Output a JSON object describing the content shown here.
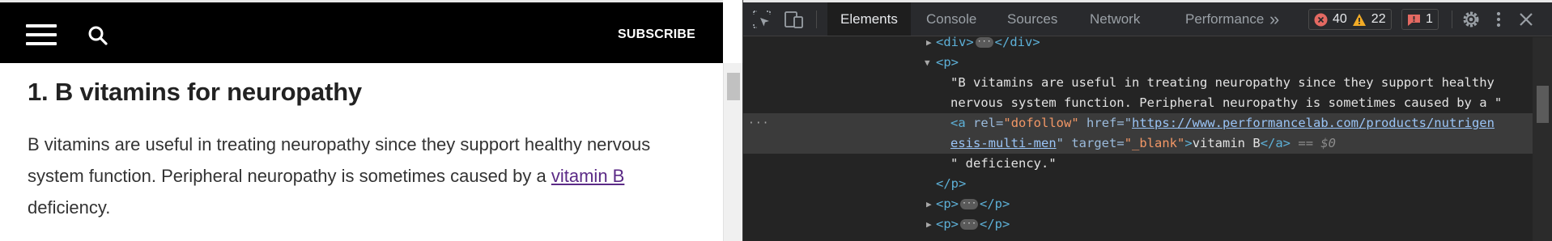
{
  "page": {
    "header": {
      "menu_icon": "hamburger-icon",
      "search_icon": "search-icon",
      "subscribe_label": "SUBSCRIBE"
    },
    "article": {
      "heading": "1. B vitamins for neuropathy",
      "para_before": "B vitamins are useful in treating neuropathy since they support healthy nervous system function. Peripheral neuropathy is sometimes caused by a ",
      "link_text": "vitamin B",
      "para_after": " deficiency."
    }
  },
  "devtools": {
    "toolbar": {
      "inspect_icon": "inspect-element-icon",
      "device_icon": "device-toolbar-icon",
      "tabs": [
        "Elements",
        "Console",
        "Sources",
        "Network",
        "Performance"
      ],
      "more_tabs": "»",
      "errors_count": "40",
      "warnings_count": "22",
      "issues_count": "1",
      "settings_icon": "gear-icon",
      "menu_icon": "vertical-dots-icon",
      "close_icon": "close-icon",
      "colors": {
        "error": "#e46962",
        "warning": "#f2ab26",
        "issue": "#e46962"
      }
    },
    "dom": {
      "div_open": "<div>",
      "div_close": "</div>",
      "p_open": "<p>",
      "p_close": "</p>",
      "text1_line1": "\"B vitamins are useful in treating neuropathy since they support healthy",
      "text1_line2": "nervous system function. Peripheral neuropathy is sometimes caused by a \"",
      "a_open_start": "<a",
      "a_rel_attr": "rel",
      "a_rel_val": "\"dofollow\"",
      "a_href_attr": "href",
      "a_href_q": "=\"",
      "a_href_line1": "https://www.performancelab.com/products/nutrigen",
      "a_href_line2": "esis-multi-men",
      "a_href_endq": "\"",
      "a_target_attr": "target",
      "a_target_val": "\"_blank\"",
      "a_gt": ">",
      "a_text": "vitamin B",
      "a_close": "</a>",
      "eq0": "== $0",
      "text2": "\" deficiency.\"",
      "gutter": "···",
      "ellipsis": "···"
    }
  }
}
